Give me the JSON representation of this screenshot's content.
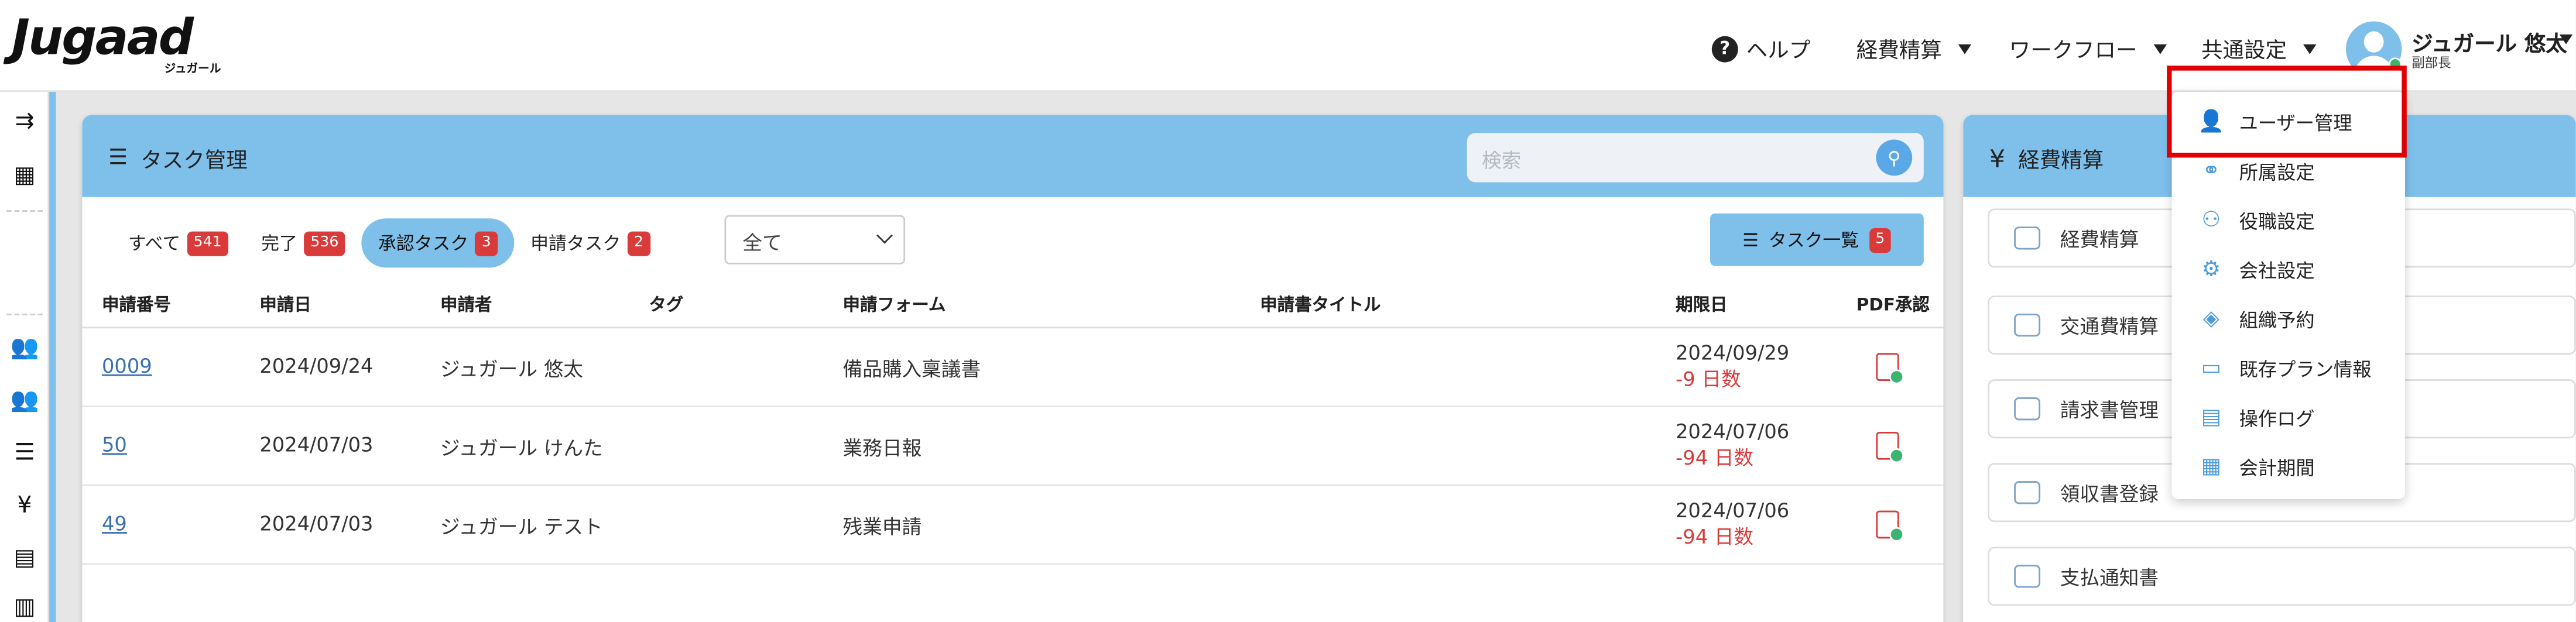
{
  "header": {
    "logo": "Jugaad",
    "logo_sub": "ジュガール",
    "help": "ヘルプ",
    "nav": [
      "経費精算",
      "ワークフロー",
      "共通設定"
    ],
    "user_name": "ジュガール 悠太",
    "user_role": "副部長"
  },
  "tasks": {
    "title": "タスク管理",
    "search_placeholder": "検索",
    "filters": [
      {
        "label": "すべて",
        "count": "541"
      },
      {
        "label": "完了",
        "count": "536"
      },
      {
        "label": "承認タスク",
        "count": "3"
      },
      {
        "label": "申請タスク",
        "count": "2"
      }
    ],
    "select_value": "全て",
    "list_button": "タスク一覧",
    "list_count": "5",
    "columns": [
      "申請番号",
      "申請日",
      "申請者",
      "タグ",
      "申請フォーム",
      "申請書タイトル",
      "期限日",
      "PDF承認"
    ],
    "rows": [
      {
        "id": "0009",
        "date": "2024/09/24",
        "applicant": "ジュガール 悠太",
        "form": "備品購入稟議書",
        "due": "2024/09/29",
        "days": "-9 日数"
      },
      {
        "id": "50",
        "date": "2024/07/03",
        "applicant": "ジュガール けんた",
        "form": "業務日報",
        "due": "2024/07/06",
        "days": "-94 日数"
      },
      {
        "id": "49",
        "date": "2024/07/03",
        "applicant": "ジュガール テスト",
        "form": "残業申請",
        "due": "2024/07/06",
        "days": "-94 日数"
      }
    ]
  },
  "expense": {
    "title": "経費精算",
    "items": [
      "経費精算",
      "交通費精算",
      "請求書管理",
      "領収書登録",
      "支払通知書"
    ]
  },
  "dropdown": {
    "items": [
      "ユーザー管理",
      "所属設定",
      "役職設定",
      "会社設定",
      "組織予約",
      "既存プラン情報",
      "操作ログ",
      "会計期間"
    ]
  },
  "colors": {
    "accent": "#7ec0ea",
    "badge": "#d93a3a",
    "highlight": "#e00000"
  }
}
